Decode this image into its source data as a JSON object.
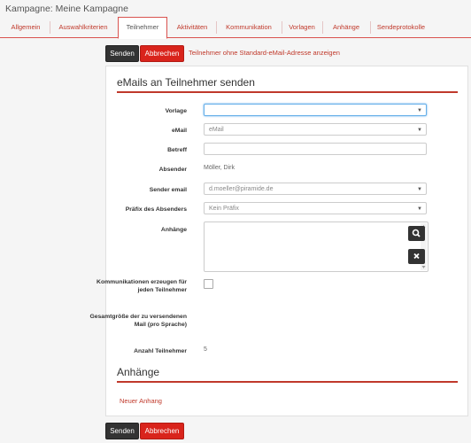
{
  "header": {
    "title": "Kampagne: Meine Kampagne"
  },
  "tabs": [
    {
      "label": "Allgemein"
    },
    {
      "label": "Auswahlkriterien"
    },
    {
      "label": "Teilnehmer"
    },
    {
      "label": "Aktivitäten"
    },
    {
      "label": "Kommunikation"
    },
    {
      "label": "Vorlagen"
    },
    {
      "label": "Anhänge"
    },
    {
      "label": "Sendeprotokolle"
    }
  ],
  "toolbar": {
    "send_label": "Senden",
    "cancel_label": "Abbrechen",
    "no_email_link": "Teilnehmer ohne Standard-eMail-Adresse anzeigen"
  },
  "form": {
    "section_title": "eMails an Teilnehmer senden",
    "vorlage_label": "Vorlage",
    "vorlage_value": "",
    "email_label": "eMail",
    "email_value": "eMail",
    "betreff_label": "Betreff",
    "betreff_value": "",
    "absender_label": "Absender",
    "absender_value": "Möller, Dirk",
    "sender_email_label": "Sender email",
    "sender_email_value": "d.moeller@piramide.de",
    "praefix_label": "Präfix des Absenders",
    "praefix_value": "Kein Präfix",
    "anhaenge_label": "Anhänge",
    "kommunikation_label": "Kommunikationen erzeugen für jeden Teilnehmer",
    "gesamtgroesse_label": "Gesamtgröße der zu versendenen Mail (pro Sprache)",
    "anzahl_label": "Anzahl Teilnehmer",
    "anzahl_value": "5"
  },
  "attachments": {
    "section_title": "Anhänge",
    "new_link": "Neuer Anhang"
  },
  "icons": {
    "search": "search-icon",
    "remove": "close-icon",
    "dropdown": "chevron-down-icon"
  },
  "colors": {
    "accent": "#c0392b",
    "button_dark": "#333333",
    "button_red": "#d9241c",
    "focus": "#66afe9"
  }
}
